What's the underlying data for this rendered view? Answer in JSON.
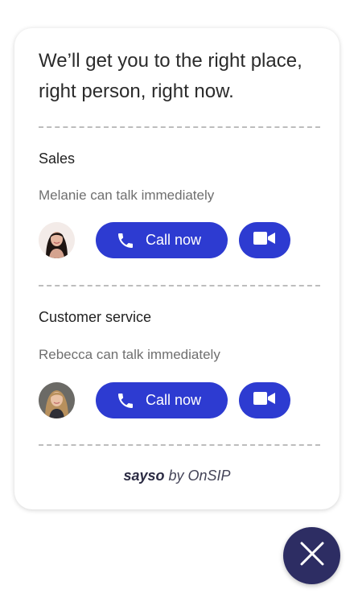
{
  "widget": {
    "headline": "We’ll get you to the right place, right person, right now.",
    "footer_brand": "sayso",
    "footer_by": "by OnSIP"
  },
  "sections": [
    {
      "title": "Sales",
      "status": "Melanie can talk immediately",
      "call_label": "Call now",
      "avatar_icon": "woman-portrait-dark-hair"
    },
    {
      "title": "Customer service",
      "status": "Rebecca can talk immediately",
      "call_label": "Call now",
      "avatar_icon": "woman-portrait-blonde-hair"
    }
  ],
  "icons": {
    "call": "phone-icon",
    "video": "video-camera-icon",
    "close": "close-icon"
  },
  "colors": {
    "accent": "#2d3bd1",
    "close_button": "#2d2d63",
    "divider": "#bdbdbd",
    "headline_text": "#2b2b2b",
    "status_text": "#6f6f6f"
  }
}
